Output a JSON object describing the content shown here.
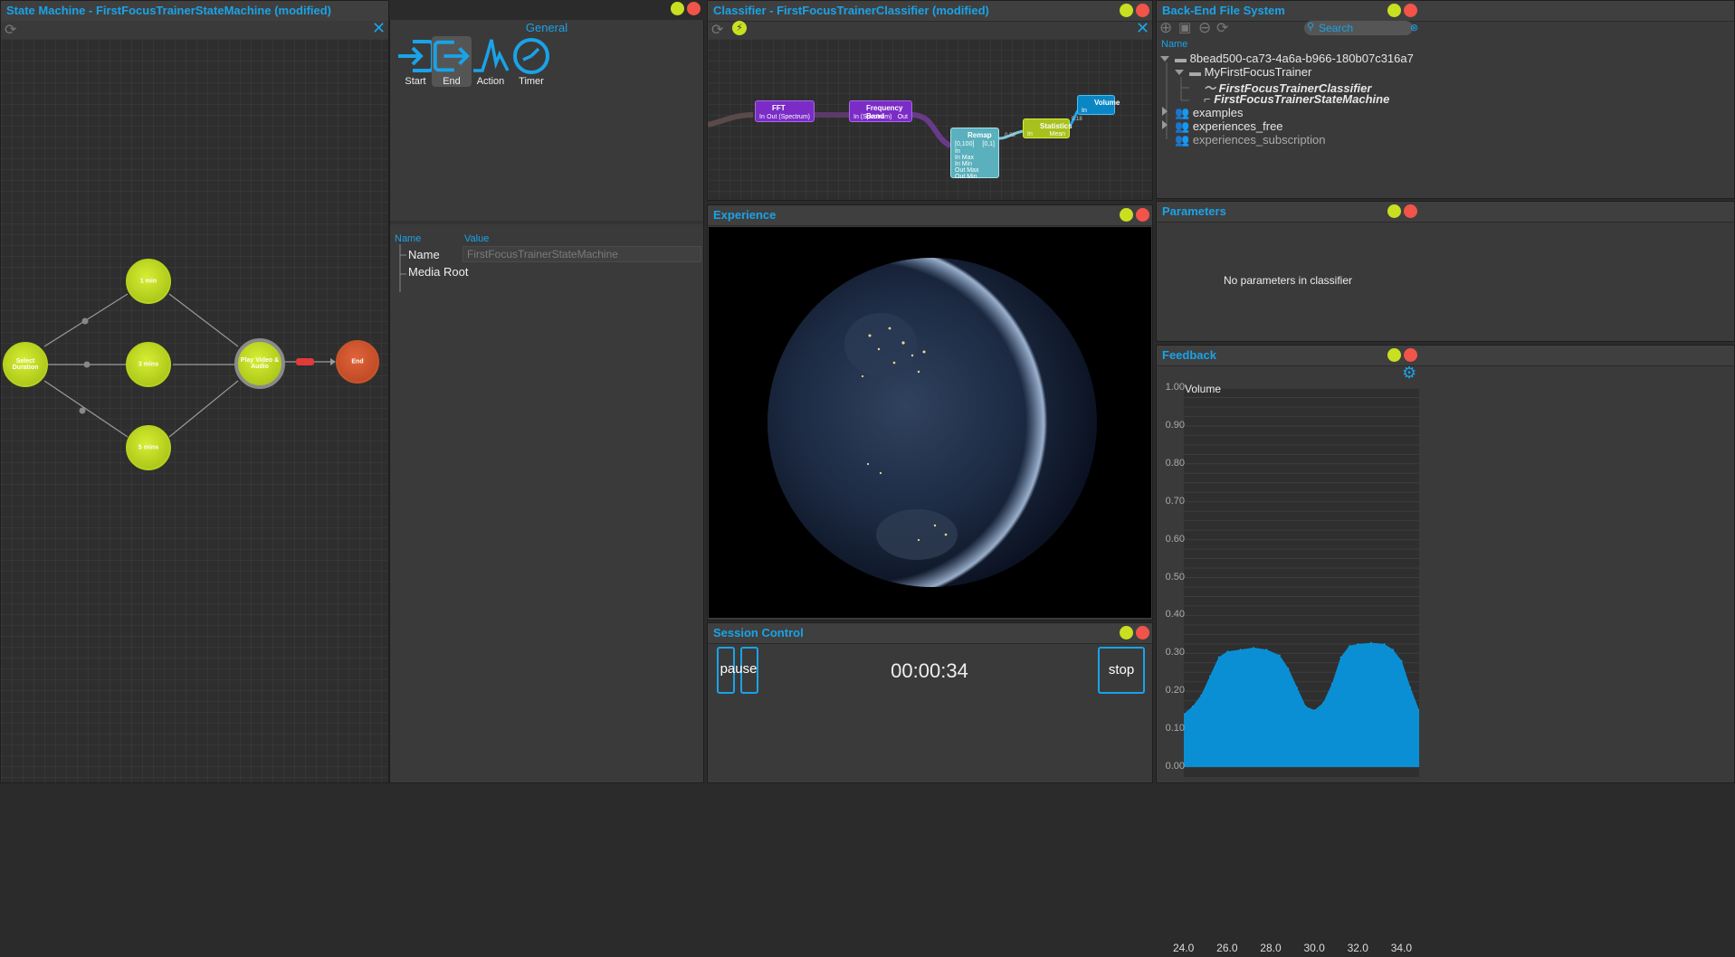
{
  "state_machine": {
    "title": "State Machine - FirstFocusTrainerStateMachine (modified)",
    "nodes": {
      "select": "Select Duration",
      "one": "1 min",
      "three": "3 mins",
      "five": "5 mins",
      "play": "Play Video & Audio",
      "end": "End"
    }
  },
  "general": {
    "title": "General",
    "tools": [
      "Start",
      "End",
      "Action",
      "Timer"
    ],
    "selected_tool": "End",
    "props_header": {
      "name": "Name",
      "value": "Value"
    },
    "props": [
      {
        "label": "Name",
        "value": "FirstFocusTrainerStateMachine"
      },
      {
        "label": "Media Root",
        "value": ""
      }
    ]
  },
  "classifier": {
    "title": "Classifier - FirstFocusTrainerClassifier (modified)",
    "nodes": {
      "fft": {
        "title": "FFT",
        "in": "In",
        "out": "Out (Spectrum)"
      },
      "band": {
        "title": "Frequency Band",
        "in": "In (Spectrum)",
        "out": "Out"
      },
      "remap": {
        "title": "Remap",
        "range_in": "[0,100]",
        "range_out": "[0,1]",
        "ports": [
          "In",
          "In Max",
          "In Min",
          "Out Max",
          "Out Min"
        ]
      },
      "stats": {
        "title": "Statistics",
        "in": "In",
        "out": "Mean"
      },
      "volume": {
        "title": "Volume",
        "in": "In"
      }
    },
    "wire_values": {
      "remap_out": "0.28",
      "stats_out": "0.18"
    }
  },
  "experience": {
    "title": "Experience"
  },
  "session": {
    "title": "Session Control",
    "pause_label": "pause",
    "timer": "00:00:34",
    "stop_label": "stop"
  },
  "filesystem": {
    "title": "Back-End File System",
    "search_placeholder": "Search",
    "column": "Name",
    "root": "8bead500-ca73-4a6a-b966-180b07c316a7",
    "folder": "MyFirstFocusTrainer",
    "classifier_file": "FirstFocusTrainerClassifier",
    "statemachine_file": "FirstFocusTrainerStateMachine",
    "groups": [
      "examples",
      "experiences_free",
      "experiences_subscription"
    ]
  },
  "parameters": {
    "title": "Parameters",
    "empty_message": "No parameters in classifier"
  },
  "feedback": {
    "title": "Feedback",
    "series_label": "Volume"
  },
  "chart_data": {
    "type": "area",
    "title": "",
    "series": [
      {
        "name": "Volume",
        "color": "#0a8fd4"
      }
    ],
    "x": [
      24.0,
      24.4,
      24.8,
      25.2,
      25.6,
      26.0,
      26.6,
      27.2,
      27.8,
      28.4,
      28.8,
      29.2,
      29.6,
      30.0,
      30.4,
      30.8,
      31.2,
      31.6,
      32.0,
      32.6,
      33.2,
      33.6,
      34.0,
      34.4,
      34.8
    ],
    "y": [
      0.14,
      0.16,
      0.19,
      0.24,
      0.29,
      0.305,
      0.31,
      0.315,
      0.31,
      0.295,
      0.26,
      0.21,
      0.16,
      0.15,
      0.17,
      0.22,
      0.29,
      0.32,
      0.325,
      0.328,
      0.325,
      0.31,
      0.28,
      0.21,
      0.15
    ],
    "xlim": [
      24.0,
      34.8
    ],
    "ylim": [
      0.0,
      1.0
    ],
    "xticks": [
      "24.0",
      "26.0",
      "28.0",
      "30.0",
      "32.0",
      "34.0"
    ],
    "yticks": [
      "0.00",
      "0.10",
      "0.20",
      "0.30",
      "0.40",
      "0.50",
      "0.60",
      "0.70",
      "0.80",
      "0.90",
      "1.00"
    ],
    "grid": true
  }
}
